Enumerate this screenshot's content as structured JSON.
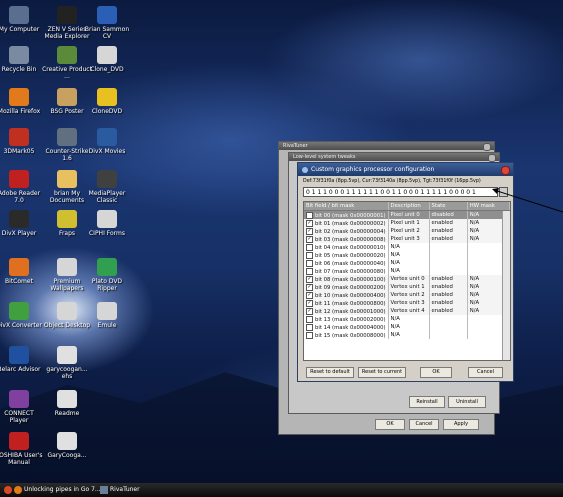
{
  "desktop_icons": [
    {
      "label": "My Computer",
      "icon": "computer-icon",
      "color": "#5a6f90"
    },
    {
      "label": "ZEN V Series Media Explorer",
      "icon": "player-icon",
      "color": "#222222"
    },
    {
      "label": "Brian Sammon CV",
      "icon": "document-icon",
      "color": "#2b5fb5"
    },
    {
      "label": "Recycle Bin",
      "icon": "recycle-bin-icon",
      "color": "#7a8aa0"
    },
    {
      "label": "Creative Product ...",
      "icon": "creative-icon",
      "color": "#5a8a3a"
    },
    {
      "label": "Clone_DVD",
      "icon": "folder-icon",
      "color": "#d6d6d6"
    },
    {
      "label": "Mozilla Firefox",
      "icon": "firefox-icon",
      "color": "#e07a1a"
    },
    {
      "label": "BSG Poster",
      "icon": "image-icon",
      "color": "#c8a060"
    },
    {
      "label": "CloneDVD",
      "icon": "clonedvd-icon",
      "color": "#e8c020"
    },
    {
      "label": "3DMark05",
      "icon": "3dmark-icon",
      "color": "#c03020"
    },
    {
      "label": "Counter-Strike 1.6",
      "icon": "counter-strike-icon",
      "color": "#607080"
    },
    {
      "label": "DivX Movies",
      "icon": "divx-icon",
      "color": "#2a5aa0"
    },
    {
      "label": "Adobe Reader 7.0",
      "icon": "adobe-reader-icon",
      "color": "#c02020"
    },
    {
      "label": "brian My Documents",
      "icon": "my-documents-icon",
      "color": "#e8c060"
    },
    {
      "label": "MediaPlayer Classic",
      "icon": "mediaplayer-icon",
      "color": "#404040"
    },
    {
      "label": "DivX Player",
      "icon": "divx-player-icon",
      "color": "#2a2a2a"
    },
    {
      "label": "Fraps",
      "icon": "fraps-icon",
      "color": "#d0c030"
    },
    {
      "label": "CIPHI Forms",
      "icon": "folder-icon",
      "color": "#d6d6d6"
    },
    {
      "label": "BitComet",
      "icon": "bitcomet-icon",
      "color": "#e07020"
    },
    {
      "label": "Premium Wallpapers",
      "icon": "folder-icon",
      "color": "#d6d6d6"
    },
    {
      "label": "Plato DVD Ripper",
      "icon": "dvd-ripper-icon",
      "color": "#30a050"
    },
    {
      "label": "DivX Converter",
      "icon": "divx-converter-icon",
      "color": "#40a040"
    },
    {
      "label": "Object Desktop",
      "icon": "folder-icon",
      "color": "#d6d6d6"
    },
    {
      "label": "Emule",
      "icon": "folder-icon",
      "color": "#d6d6d6"
    },
    {
      "label": "Belarc Advisor",
      "icon": "belarc-icon",
      "color": "#2050a0"
    },
    {
      "label": "garycoogan... ehs",
      "icon": "document-icon",
      "color": "#e0e0e0"
    },
    {
      "label": "",
      "icon": "",
      "color": ""
    },
    {
      "label": "CONNECT Player",
      "icon": "connect-player-icon",
      "color": "#8040a0"
    },
    {
      "label": "Readme",
      "icon": "document-icon",
      "color": "#e0e0e0"
    },
    {
      "label": "",
      "icon": "",
      "color": ""
    },
    {
      "label": "TOSHIBA User's Manual",
      "icon": "toshiba-icon",
      "color": "#c02020"
    },
    {
      "label": "GaryCooga...",
      "icon": "document-icon",
      "color": "#e0e0e0"
    }
  ],
  "back_window": {
    "title": "RivaTuner"
  },
  "mid_window": {
    "title": "Low-level system tweaks"
  },
  "dialog": {
    "title": "Custom graphics processor configuration",
    "config_line": "Def:73f31f0a (8pp.5vp), Cur:73f3140a (8pp.5vp), Tgt:73f31f0f (16pp.5vp)",
    "bitmask": "0 1 1 1 0 0 0 1 1 1 1 1 1 0 0 1 1 0 0 0 1 1 1 1 1 0 0 0 0 1",
    "columns": [
      "Bit field / bit mask",
      "Description",
      "State",
      "HW mask"
    ],
    "rows": [
      {
        "bit": "bit 00 (mask 0x00000001)",
        "desc": "Pixel unit 0",
        "state": "disabled",
        "hw": "N/A",
        "checked": true
      },
      {
        "bit": "bit 01 (mask 0x00000002)",
        "desc": "Pixel unit 1",
        "state": "enabled",
        "hw": "N/A",
        "checked": true
      },
      {
        "bit": "bit 02 (mask 0x00000004)",
        "desc": "Pixel unit 2",
        "state": "enabled",
        "hw": "N/A",
        "checked": true
      },
      {
        "bit": "bit 03 (mask 0x00000008)",
        "desc": "Pixel unit 3",
        "state": "enabled",
        "hw": "N/A",
        "checked": true
      },
      {
        "bit": "bit 04 (mask 0x00000010)",
        "desc": "N/A",
        "state": "",
        "hw": "",
        "checked": false
      },
      {
        "bit": "bit 05 (mask 0x00000020)",
        "desc": "N/A",
        "state": "",
        "hw": "",
        "checked": false
      },
      {
        "bit": "bit 06 (mask 0x00000040)",
        "desc": "N/A",
        "state": "",
        "hw": "",
        "checked": false
      },
      {
        "bit": "bit 07 (mask 0x00000080)",
        "desc": "N/A",
        "state": "",
        "hw": "",
        "checked": false
      },
      {
        "bit": "bit 08 (mask 0x00000100)",
        "desc": "Vertex unit 0",
        "state": "enabled",
        "hw": "N/A",
        "checked": true
      },
      {
        "bit": "bit 09 (mask 0x00000200)",
        "desc": "Vertex unit 1",
        "state": "enabled",
        "hw": "N/A",
        "checked": true
      },
      {
        "bit": "bit 10 (mask 0x00000400)",
        "desc": "Vertex unit 2",
        "state": "enabled",
        "hw": "N/A",
        "checked": true
      },
      {
        "bit": "bit 11 (mask 0x00000800)",
        "desc": "Vertex unit 3",
        "state": "enabled",
        "hw": "N/A",
        "checked": true
      },
      {
        "bit": "bit 12 (mask 0x00001000)",
        "desc": "Vertex unit 4",
        "state": "enabled",
        "hw": "N/A",
        "checked": true
      },
      {
        "bit": "bit 13 (mask 0x00002000)",
        "desc": "N/A",
        "state": "",
        "hw": "",
        "checked": false
      },
      {
        "bit": "bit 14 (mask 0x00004000)",
        "desc": "N/A",
        "state": "",
        "hw": "",
        "checked": false
      },
      {
        "bit": "bit 15 (mask 0x00008000)",
        "desc": "N/A",
        "state": "",
        "hw": "",
        "checked": false
      }
    ],
    "buttons": {
      "reset_default": "Reset to default",
      "reset_current": "Reset to current",
      "ok": "OK",
      "cancel": "Cancel"
    }
  },
  "mid_buttons": {
    "reinstall": "Reinstall",
    "uninstall": "Uninstall"
  },
  "back_buttons": {
    "ok": "OK",
    "cancel": "Cancel",
    "apply": "Apply"
  },
  "taskbar": {
    "items": [
      "Unlocking pipes in Go 7...",
      "RivaTuner"
    ]
  }
}
